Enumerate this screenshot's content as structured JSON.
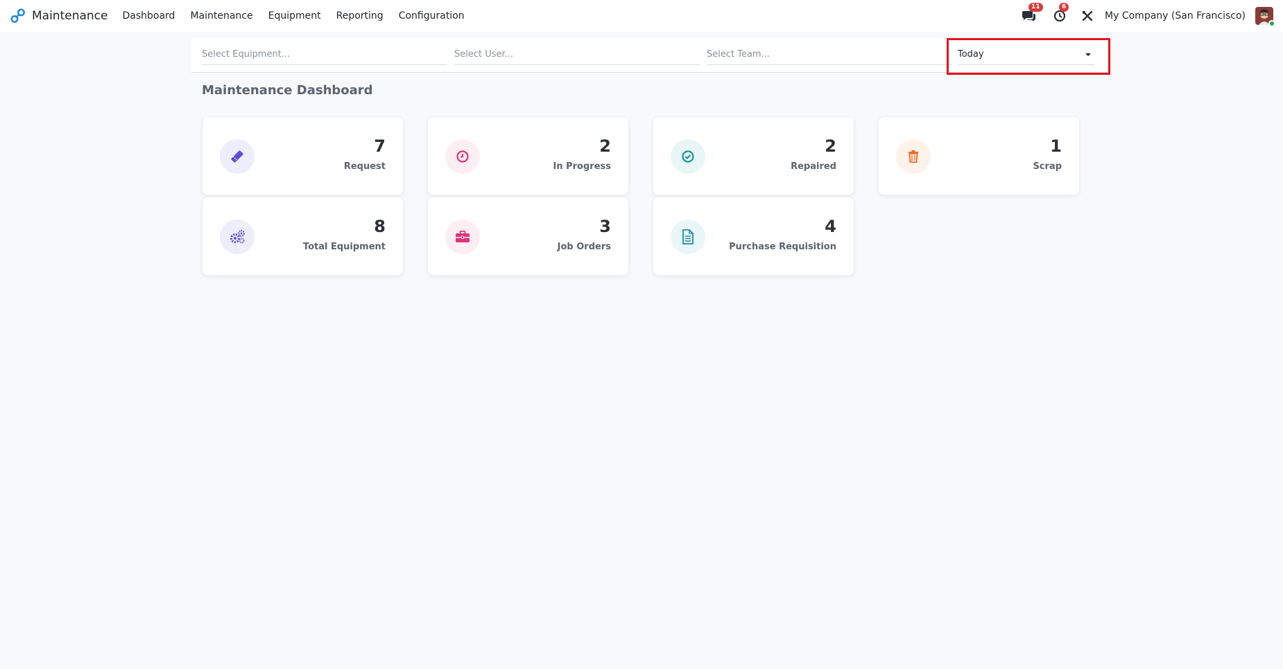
{
  "navbar": {
    "app_name": "Maintenance",
    "menu": [
      "Dashboard",
      "Maintenance",
      "Equipment",
      "Reporting",
      "Configuration"
    ],
    "messages_badge": "11",
    "activities_badge": "6",
    "company": "My Company (San Francisco)"
  },
  "filters": {
    "equipment_placeholder": "Select Equipment...",
    "user_placeholder": "Select User...",
    "team_placeholder": "Select Team...",
    "date_range": "Today"
  },
  "dashboard": {
    "title": "Maintenance Dashboard",
    "cards": [
      {
        "value": "7",
        "label": "Request",
        "icon": "ticket-icon",
        "color": "#5b4fd6",
        "bg": "#eeedfb"
      },
      {
        "value": "2",
        "label": "In Progress",
        "icon": "clock-icon",
        "color": "#e0337a",
        "bg": "#fdeef4"
      },
      {
        "value": "2",
        "label": "Repaired",
        "icon": "check-circle-icon",
        "color": "#1b8fa6",
        "bg": "#e9f6f8"
      },
      {
        "value": "1",
        "label": "Scrap",
        "icon": "trash-icon",
        "color": "#ef6a23",
        "bg": "#fef2ea"
      },
      {
        "value": "8",
        "label": "Total Equipment",
        "icon": "gears-icon",
        "color": "#5b4fd6",
        "bg": "#eeedfb"
      },
      {
        "value": "3",
        "label": "Job Orders",
        "icon": "briefcase-icon",
        "color": "#e0337a",
        "bg": "#fdeef4"
      },
      {
        "value": "4",
        "label": "Purchase Requisition",
        "icon": "document-icon",
        "color": "#1b8fa6",
        "bg": "#e9f6f8"
      }
    ]
  },
  "colors": {
    "highlight": "#e3141d",
    "badge": "#d93c3c",
    "brand_primary": "#2a8bd6"
  }
}
